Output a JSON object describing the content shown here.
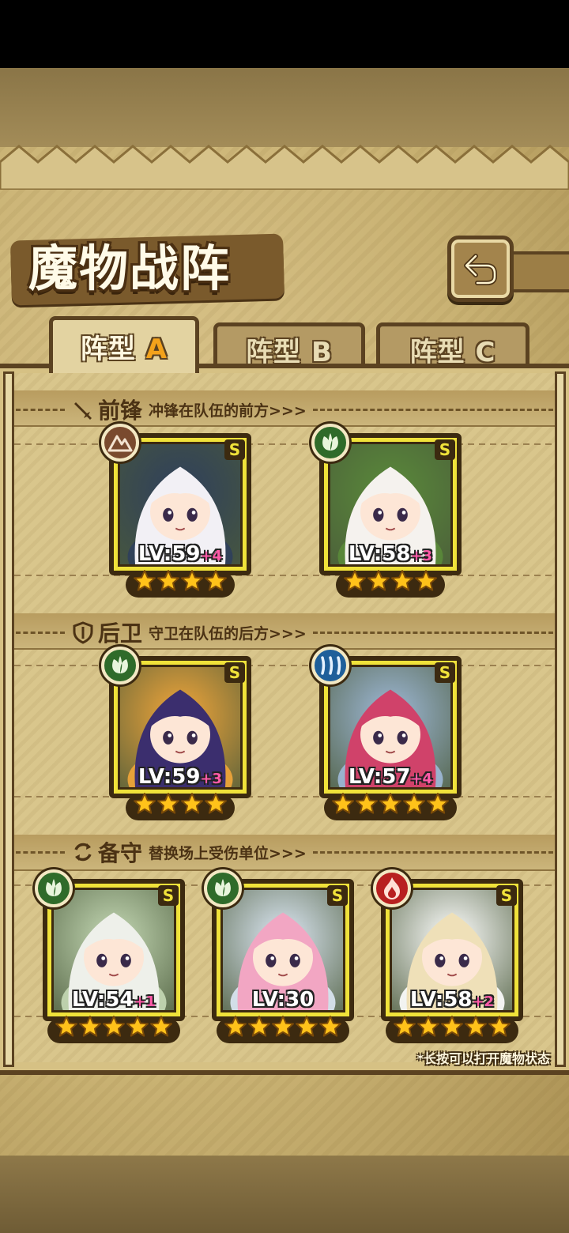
{
  "title": "魔物战阵",
  "tabs": [
    {
      "prefix": "阵型",
      "letter": "A",
      "active": true
    },
    {
      "prefix": "阵型",
      "letter": "B",
      "active": false
    },
    {
      "prefix": "阵型",
      "letter": "C",
      "active": false
    }
  ],
  "sections": {
    "front": {
      "title": "前锋",
      "desc": "冲锋在队伍的前方>>>",
      "icon": "sword-icon"
    },
    "back": {
      "title": "后卫",
      "desc": "守卫在队伍的后方>>>",
      "icon": "shield-icon"
    },
    "reserve": {
      "title": "备守",
      "desc": "替换场上受伤单位>>>",
      "icon": "swap-icon"
    }
  },
  "units": {
    "front": [
      {
        "rarity": "S",
        "element": "earth-icon",
        "element_color": "#7a4a2e",
        "level": "LV:59",
        "plus": "+4",
        "stars": 4,
        "hair": "#f2f0f5",
        "accent": "#2f3f5c"
      },
      {
        "rarity": "S",
        "element": "leaf-icon",
        "element_color": "#2f6b2a",
        "level": "LV:58",
        "plus": "+3",
        "stars": 4,
        "hair": "#f5f2ee",
        "accent": "#5a8a3a"
      }
    ],
    "back": [
      {
        "rarity": "S",
        "element": "leaf-icon",
        "element_color": "#2f6b2a",
        "level": "LV:59",
        "plus": "+3",
        "stars": 4,
        "hair": "#3b2e6e",
        "accent": "#f2a63a"
      },
      {
        "rarity": "S",
        "element": "water-icon",
        "element_color": "#1f5f9a",
        "level": "LV:57",
        "plus": "+4",
        "stars": 5,
        "hair": "#d0426a",
        "accent": "#9fb9d8"
      }
    ],
    "reserve": [
      {
        "rarity": "S",
        "element": "leaf-icon",
        "element_color": "#2f6b2a",
        "level": "LV:54",
        "plus": "+1",
        "stars": 5,
        "hair": "#eef0ea",
        "accent": "#c5d9b5"
      },
      {
        "rarity": "S",
        "element": "leaf-icon",
        "element_color": "#2f6b2a",
        "level": "LV:30",
        "plus": "",
        "stars": 5,
        "hair": "#f2a6c3",
        "accent": "#dde8f5"
      },
      {
        "rarity": "S",
        "element": "fire-icon",
        "element_color": "#b82020",
        "level": "LV:58",
        "plus": "+2",
        "stars": 5,
        "hair": "#efe0b8",
        "accent": "#ffffff"
      }
    ]
  },
  "footnote": "*长按可以打开魔物状态"
}
